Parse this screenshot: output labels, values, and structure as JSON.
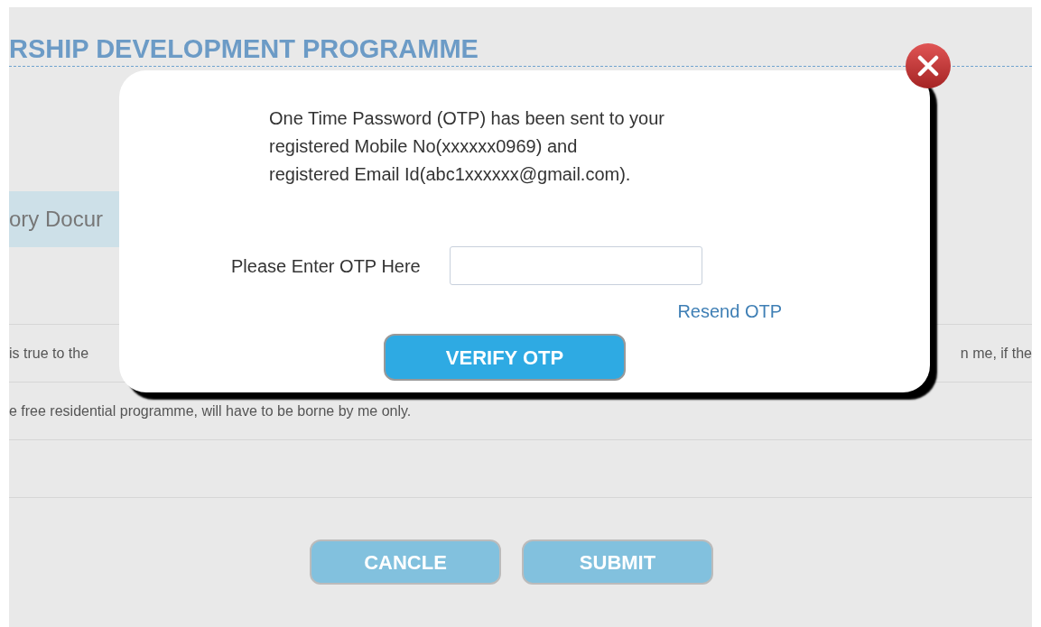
{
  "page": {
    "heading": "RSHIP DEVELOPMENT PROGRAMME",
    "tab": {
      "label": "ory Docur",
      "selected": true
    },
    "rows": [
      {
        "left": "is true to the",
        "right": "n me, if the"
      },
      {
        "left": "e free residential programme, will have to be borne by me only."
      }
    ],
    "buttons": [
      {
        "label": "CANCLE"
      },
      {
        "label": "SUBMIT"
      }
    ]
  },
  "dialog": {
    "message": [
      "One Time Password (OTP) has been sent to your",
      "registered Mobile No(xxxxxx0969) and",
      "registered Email Id(abc1xxxxxx@gmail.com)."
    ],
    "otp_label": "Please Enter OTP Here",
    "resend_link": "Resend OTP",
    "verify_button": "VERIFY OTP"
  }
}
